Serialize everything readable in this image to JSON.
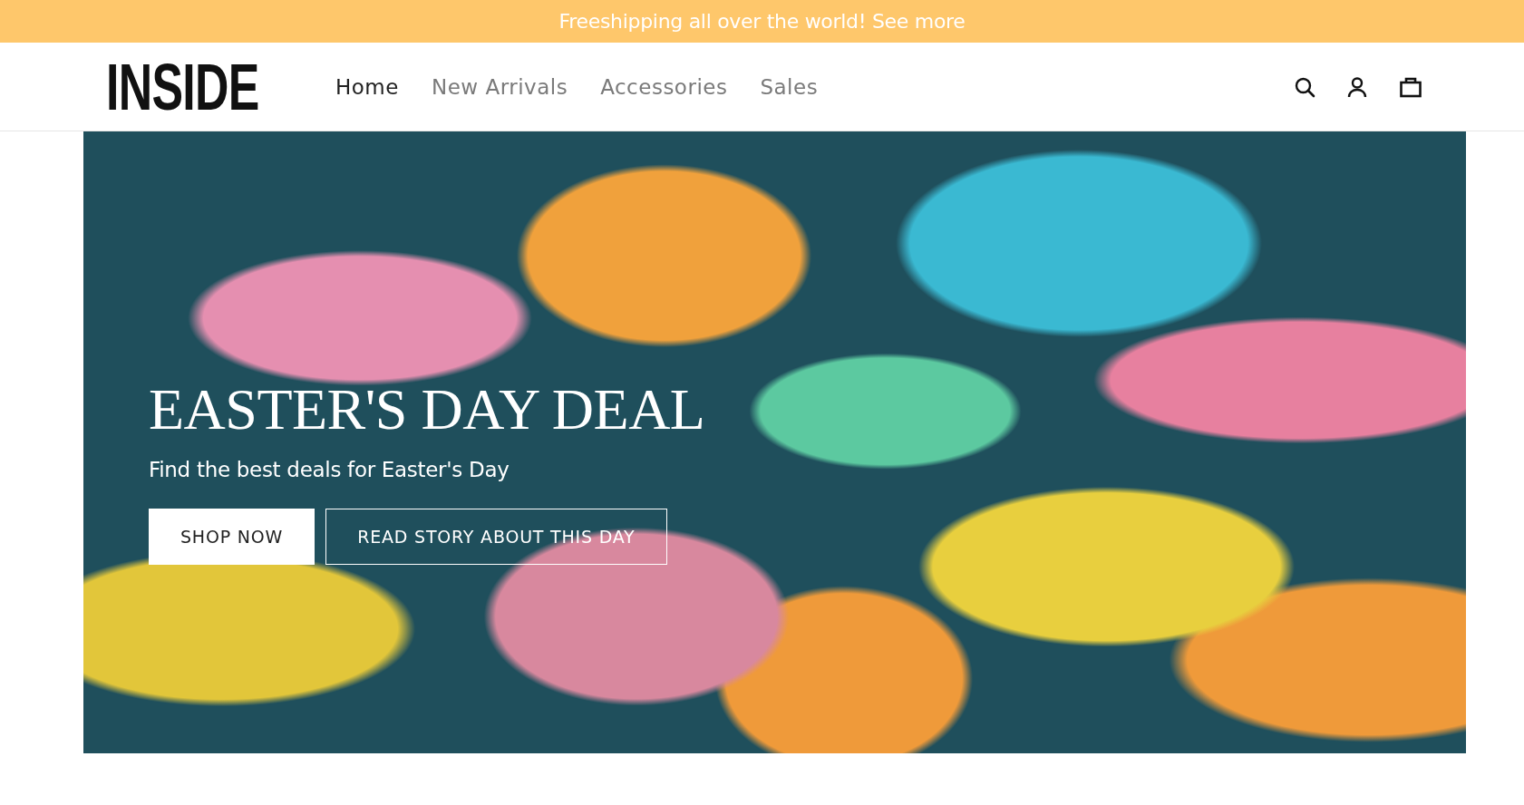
{
  "announcement": {
    "text": "Freeshipping all over the world! See more"
  },
  "header": {
    "logo": "INSIDE",
    "nav": [
      {
        "label": "Home",
        "selected": true
      },
      {
        "label": "New Arrivals",
        "selected": false
      },
      {
        "label": "Accessories",
        "selected": false
      },
      {
        "label": "Sales",
        "selected": false
      }
    ]
  },
  "hero": {
    "title": "EASTER'S DAY DEAL",
    "subtitle": "Find the best deals for Easter's Day",
    "buttons": [
      {
        "label": "SHOP NOW",
        "kind": "solid"
      },
      {
        "label": "READ STORY ABOUT THIS DAY",
        "kind": "outline"
      }
    ]
  }
}
